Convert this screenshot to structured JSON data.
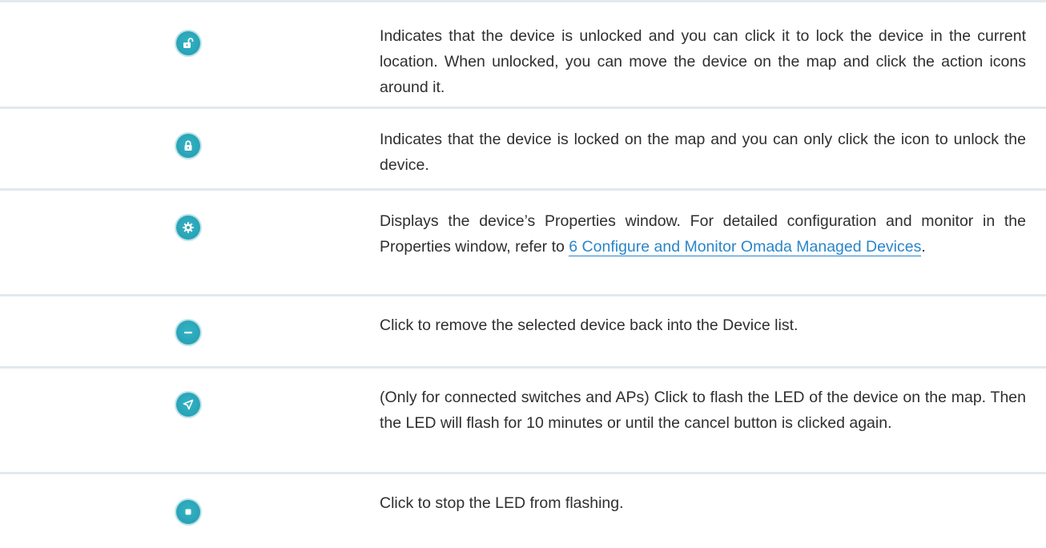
{
  "rows": [
    {
      "icon": "unlock-icon",
      "description": "Indicates that the device is unlocked and you can click it to lock the device in the current location. When unlocked, you can move the device on the map and click the action icons around it."
    },
    {
      "icon": "lock-icon",
      "description": "Indicates that the device is locked on the map and you can only click the icon to unlock the device."
    },
    {
      "icon": "gear-icon",
      "description_before": "Displays the device’s Properties window. For detailed configuration and monitor in the Properties window, refer to ",
      "link_text": "6 Configure and Monitor Omada Managed Devices",
      "description_after": "."
    },
    {
      "icon": "minus-icon",
      "description": "Click to remove the selected device back into the Device list."
    },
    {
      "icon": "locate-arrow-icon",
      "description": "(Only for connected switches and APs) Click to flash the LED of the device on the map. Then the LED will flash for 10 minutes or until the cancel button is clicked again."
    },
    {
      "icon": "stop-icon",
      "description": "Click to stop the LED from flashing."
    }
  ],
  "colors": {
    "icon_fill": "#2aa5b8",
    "icon_ring": "#bfe3e9",
    "divider": "#e2e8ef",
    "link": "#2a86c8",
    "text": "#2f2f2f"
  }
}
